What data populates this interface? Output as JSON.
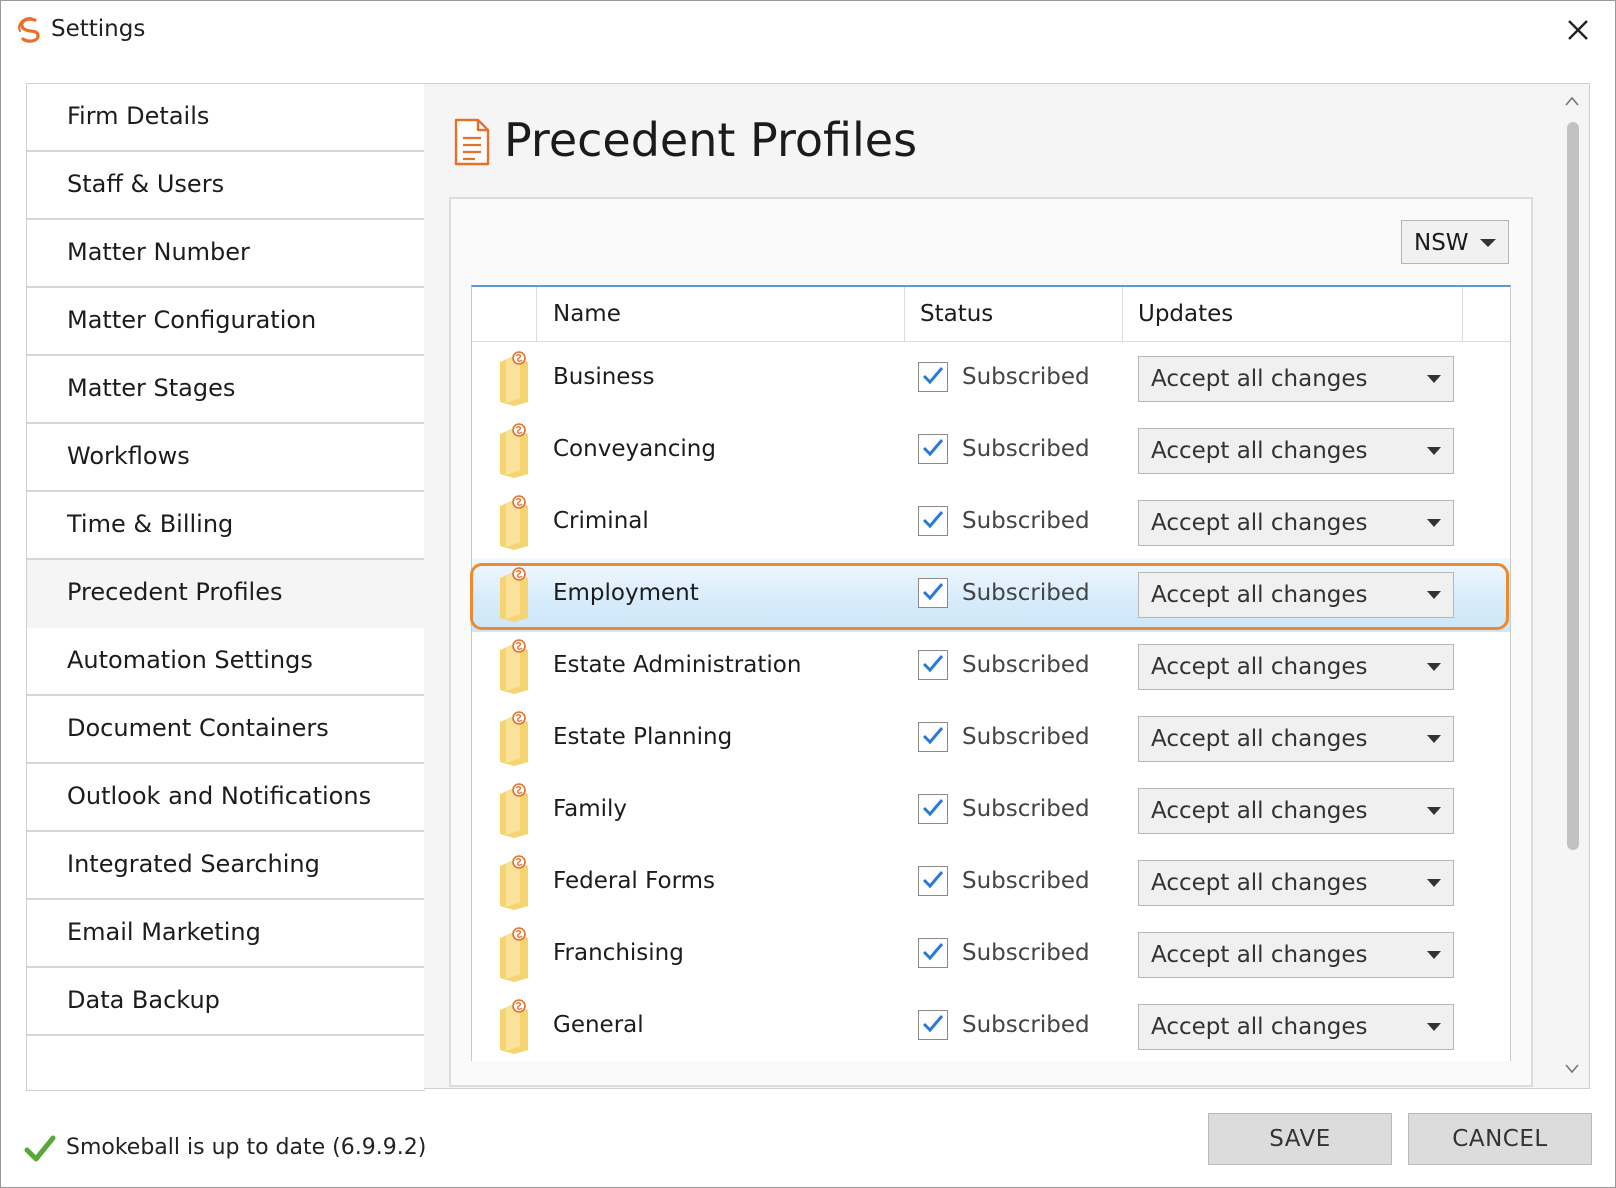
{
  "window": {
    "title": "Settings",
    "close_icon": "close-icon",
    "logo_color": "#e8702a"
  },
  "sidebar": {
    "items": [
      {
        "label": "Firm Details"
      },
      {
        "label": "Staff & Users"
      },
      {
        "label": "Matter Number"
      },
      {
        "label": "Matter Configuration"
      },
      {
        "label": "Matter Stages"
      },
      {
        "label": "Workflows"
      },
      {
        "label": "Time & Billing"
      },
      {
        "label": "Precedent Profiles",
        "active": true
      },
      {
        "label": "Automation Settings"
      },
      {
        "label": "Document Containers"
      },
      {
        "label": "Outlook and Notifications"
      },
      {
        "label": "Integrated Searching"
      },
      {
        "label": "Email Marketing"
      },
      {
        "label": "Data Backup"
      }
    ]
  },
  "main": {
    "title": "Precedent Profiles",
    "title_icon": "document-icon",
    "state_select": {
      "value": "NSW"
    },
    "table": {
      "columns": [
        "Name",
        "Status",
        "Updates"
      ],
      "rows": [
        {
          "name": "Business",
          "status": "Subscribed",
          "checked": true,
          "update": "Accept all changes"
        },
        {
          "name": "Conveyancing",
          "status": "Subscribed",
          "checked": true,
          "update": "Accept all changes"
        },
        {
          "name": "Criminal",
          "status": "Subscribed",
          "checked": true,
          "update": "Accept all changes"
        },
        {
          "name": "Employment",
          "status": "Subscribed",
          "checked": true,
          "update": "Accept all changes",
          "selected": true
        },
        {
          "name": "Estate Administration",
          "status": "Subscribed",
          "checked": true,
          "update": "Accept all changes"
        },
        {
          "name": "Estate Planning",
          "status": "Subscribed",
          "checked": true,
          "update": "Accept all changes"
        },
        {
          "name": "Family",
          "status": "Subscribed",
          "checked": true,
          "update": "Accept all changes"
        },
        {
          "name": "Federal Forms",
          "status": "Subscribed",
          "checked": true,
          "update": "Accept all changes"
        },
        {
          "name": "Franchising",
          "status": "Subscribed",
          "checked": true,
          "update": "Accept all changes"
        },
        {
          "name": "General",
          "status": "Subscribed",
          "checked": true,
          "update": "Accept all changes"
        }
      ]
    }
  },
  "footer": {
    "status": "Smokeball is up to date (6.9.9.2)",
    "save_label": "SAVE",
    "cancel_label": "CANCEL"
  },
  "colors": {
    "highlight": "#ed8a2f",
    "check": "#2b7bd6",
    "status_ok": "#5aa83a",
    "grid_top_border": "#5b9bd5"
  }
}
